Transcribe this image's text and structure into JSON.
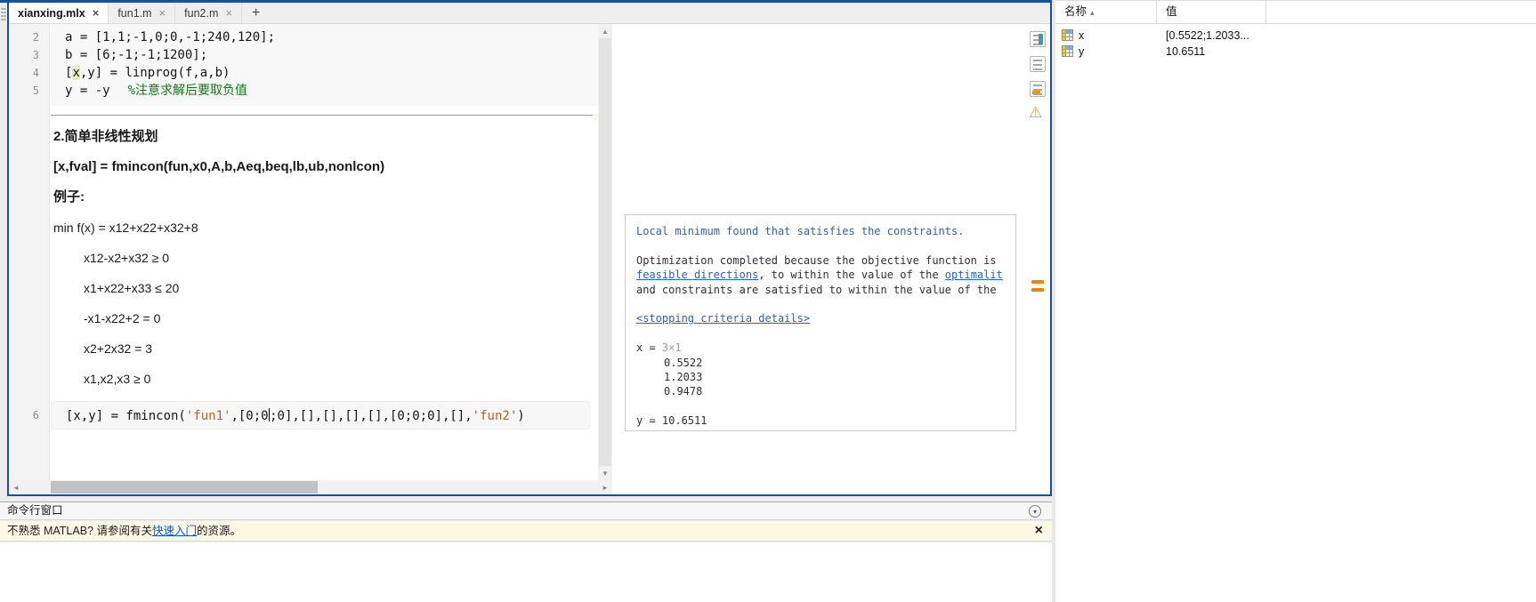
{
  "tabs": [
    {
      "label": "xianxing.mlx"
    },
    {
      "label": "fun1.m"
    },
    {
      "label": "fun2.m"
    }
  ],
  "tabbar": {
    "new_tab": "+"
  },
  "gutter": [
    "2",
    "3",
    "4",
    "5",
    "6"
  ],
  "code1": {
    "l2": "a = [1,1;-1,0;0,-1;240,120];",
    "l3": "b = [6;-1;-1;1200];",
    "l4_pre": "[",
    "l4_hl": "x",
    "l4_post": ",y] = linprog(f,a,b)",
    "l5_code": "y = -y",
    "l5_comment": "%注意求解后要取负值"
  },
  "text": {
    "heading": "2.简单非线性规划",
    "syntax": "[x,fval] = fmincon(fun,x0,A,b,Aeq,beq,lb,ub,nonlcon)",
    "example": "例子:",
    "objective": "min f(x) = x12+x22+x32+8",
    "c1": "x12-x2+x32 ≥ 0",
    "c2": "x1+x22+x33 ≤ 20",
    "c3": "-x1-x22+2 = 0",
    "c4": "x2+2x32 = 3",
    "c5": "x1,x2,x3 ≥ 0"
  },
  "code2": {
    "s1": "[x,y] = fmincon(",
    "s2": "'fun1'",
    "s3": ",[0;0",
    "s4": ";0],[],[],[],[],[0;0;0],[],",
    "s5": "'fun2'",
    "s6": ")"
  },
  "output": {
    "line1": "Local minimum found that satisfies the constraints.",
    "opt1": "Optimization completed because the objective function is",
    "feasible_link": "feasible directions",
    "opt2": ", to within the value of the ",
    "optimality_link": "optimalit",
    "opt3": "and constraints are satisfied to within the value of the",
    "stopping": "<stopping criteria details>",
    "x_label": "x = ",
    "x_dim": "3×1",
    "v1": "0.5522",
    "v2": "1.2033",
    "v3": "0.9478",
    "y_line": "y = 10.6511"
  },
  "workspace": {
    "col_name": "名称",
    "col_value": "值",
    "rows": [
      {
        "name": "x",
        "value": "[0.5522;1.2033..."
      },
      {
        "name": "y",
        "value": "10.6511"
      }
    ]
  },
  "command_window": {
    "title": "命令行窗口",
    "banner_pre": "不熟悉 MATLAB? 请参阅有关",
    "banner_link": "快速入门",
    "banner_post": "的资源。"
  },
  "icons": {
    "close": "×",
    "scroll_up": "▲",
    "scroll_down": "▼",
    "scroll_left": "◄",
    "scroll_right": "►",
    "warning": "⚠",
    "collapse_chevron": "▾",
    "sort_asc": "▴"
  },
  "colors": {
    "accent_blue": "#1b4f9c",
    "section_line_blue": "#6aa7e0",
    "comment_green": "#107a10",
    "string_orange": "#b5651d",
    "link_blue": "#2a62bc",
    "warning_orange": "#efa11b",
    "highlight_green": "#e2edbe",
    "scroll_mark_orange": "#e58a00"
  }
}
